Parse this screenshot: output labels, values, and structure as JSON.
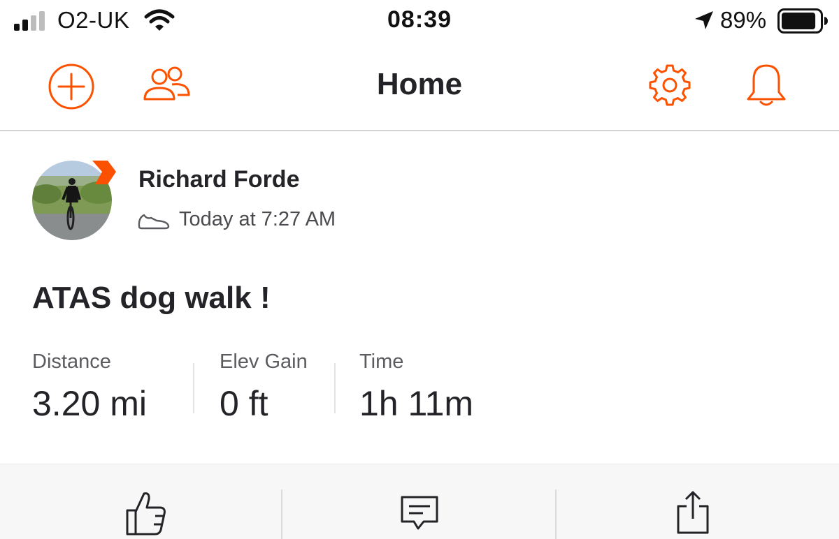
{
  "status_bar": {
    "carrier": "O2-UK",
    "time": "08:39",
    "battery_percent": "89%",
    "battery_level": 0.89,
    "signal_bars_active": 2,
    "signal_bars_total": 4
  },
  "nav": {
    "title": "Home",
    "add_icon": "plus-circle-icon",
    "friends_icon": "people-icon",
    "settings_icon": "gear-icon",
    "notifications_icon": "bell-icon"
  },
  "activity": {
    "athlete_name": "Richard Forde",
    "activity_icon": "shoe-icon",
    "timestamp": "Today at 7:27 AM",
    "title": "ATAS dog walk !",
    "stats": [
      {
        "label": "Distance",
        "value": "3.20 mi"
      },
      {
        "label": "Elev Gain",
        "value": "0 ft"
      },
      {
        "label": "Time",
        "value": "1h 11m"
      }
    ]
  },
  "actions": {
    "kudos_icon": "thumbs-up-icon",
    "comment_icon": "comment-icon",
    "share_icon": "share-icon"
  },
  "colors": {
    "accent": "#fc5200",
    "text_primary": "#242428",
    "text_secondary": "#5b5b60",
    "action_bar_bg": "#f7f7f7"
  }
}
